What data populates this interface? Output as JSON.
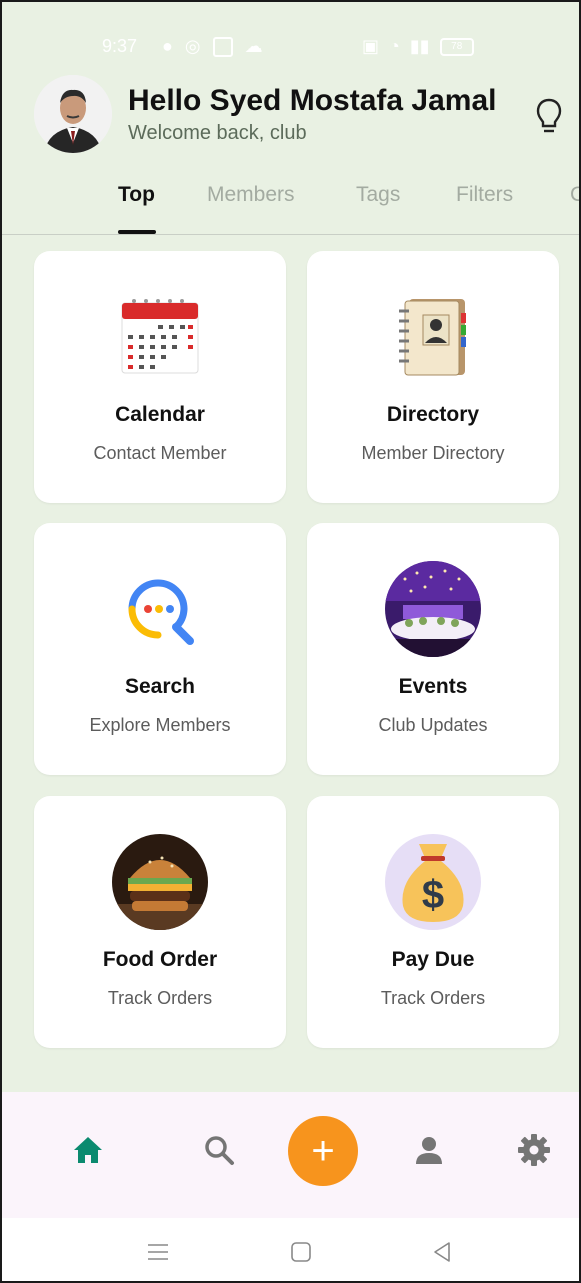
{
  "status_bar": {
    "time": "9:37",
    "battery": "78"
  },
  "header": {
    "greeting": "Hello Syed Mostafa Jamal",
    "subtitle": "Welcome back, club"
  },
  "tabs": [
    {
      "label": "Top",
      "active": true
    },
    {
      "label": "Members",
      "active": false
    },
    {
      "label": "Tags",
      "active": false
    },
    {
      "label": "Filters",
      "active": false
    },
    {
      "label": "C",
      "active": false
    }
  ],
  "cards": [
    {
      "title": "Calendar",
      "subtitle": "Contact Member",
      "icon": "calendar-icon"
    },
    {
      "title": "Directory",
      "subtitle": "Member Directory",
      "icon": "directory-icon"
    },
    {
      "title": "Search",
      "subtitle": "Explore Members",
      "icon": "search-icon"
    },
    {
      "title": "Events",
      "subtitle": "Club Updates",
      "icon": "events-icon"
    },
    {
      "title": "Food Order",
      "subtitle": "Track Orders",
      "icon": "burger-icon"
    },
    {
      "title": "Pay Due",
      "subtitle": "Track Orders",
      "icon": "money-bag-icon"
    }
  ],
  "bottom_nav": {
    "items": [
      "home-icon",
      "search-icon",
      "add-icon",
      "profile-icon",
      "settings-icon"
    ],
    "fab_label": "+"
  },
  "colors": {
    "background": "#e9f1e3",
    "active_nav": "#0b8a6f",
    "fab": "#f7941d",
    "nav_background": "#fbf4fb"
  }
}
